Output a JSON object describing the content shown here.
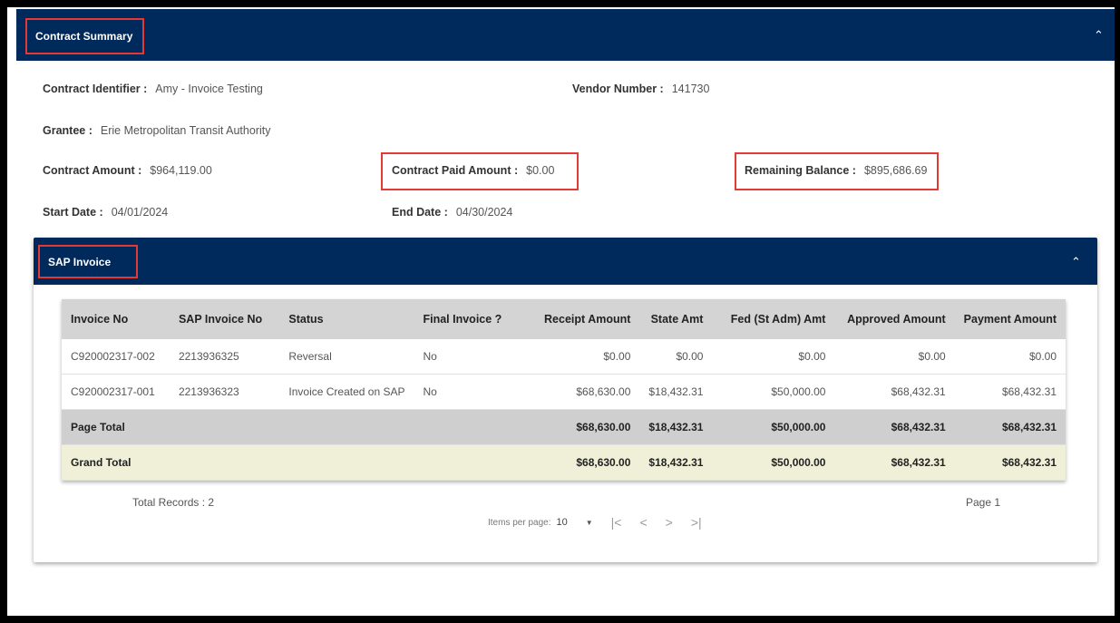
{
  "contract_summary": {
    "title": "Contract Summary",
    "collapse_icon": "chevron-up-icon",
    "fields": {
      "contract_identifier": {
        "label": "Contract Identifier :",
        "value": "Amy - Invoice Testing"
      },
      "vendor_number": {
        "label": "Vendor Number :",
        "value": "141730"
      },
      "grantee": {
        "label": "Grantee :",
        "value": "Erie Metropolitan Transit Authority"
      },
      "contract_amount": {
        "label": "Contract Amount :",
        "value": "$964,119.00"
      },
      "contract_paid_amount": {
        "label": "Contract Paid Amount :",
        "value": "$0.00"
      },
      "remaining_balance": {
        "label": "Remaining Balance :",
        "value": "$895,686.69"
      },
      "start_date": {
        "label": "Start Date :",
        "value": "04/01/2024"
      },
      "end_date": {
        "label": "End Date :",
        "value": "04/30/2024"
      }
    }
  },
  "sap_invoice": {
    "title": "SAP Invoice",
    "collapse_icon": "chevron-up-icon",
    "columns": [
      "Invoice No",
      "SAP Invoice No",
      "Status",
      "Final Invoice ?",
      "Receipt Amount",
      "State Amt",
      "Fed (St Adm) Amt",
      "Approved Amount",
      "Payment Amount"
    ],
    "rows": [
      [
        "C920002317-002",
        "2213936325",
        "Reversal",
        "No",
        "$0.00",
        "$0.00",
        "$0.00",
        "$0.00",
        "$0.00"
      ],
      [
        "C920002317-001",
        "2213936323",
        "Invoice Created on SAP",
        "No",
        "$68,630.00",
        "$18,432.31",
        "$50,000.00",
        "$68,432.31",
        "$68,432.31"
      ]
    ],
    "page_total": {
      "label": "Page Total",
      "values": [
        "$68,630.00",
        "$18,432.31",
        "$50,000.00",
        "$68,432.31",
        "$68,432.31"
      ]
    },
    "grand_total": {
      "label": "Grand Total",
      "values": [
        "$68,630.00",
        "$18,432.31",
        "$50,000.00",
        "$68,432.31",
        "$68,432.31"
      ]
    },
    "total_records": "Total Records : 2",
    "items_per_page_label": "Items per page:",
    "items_per_page_value": "10",
    "page_label": "Page 1",
    "highlight_color": "#e53935",
    "header_color": "#002a5c"
  }
}
